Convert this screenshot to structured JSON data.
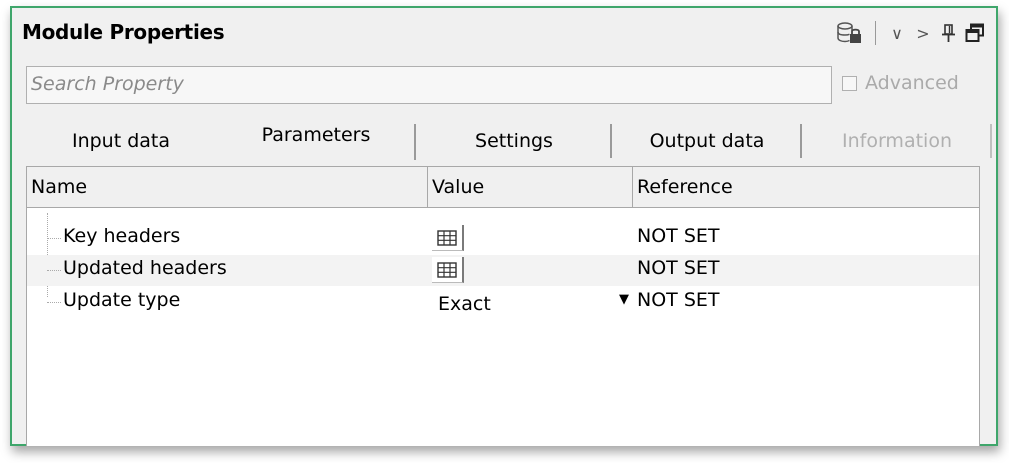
{
  "window": {
    "title": "Module Properties"
  },
  "titlebar": {
    "icons": [
      "database-lock-icon",
      "chevron-down-icon",
      "chevron-right-icon",
      "pin-icon",
      "restore-window-icon"
    ],
    "chevron_down": "∨",
    "chevron_right": ">"
  },
  "search": {
    "placeholder": "Search Property",
    "value": ""
  },
  "advanced": {
    "label": "Advanced",
    "checked": false,
    "enabled": false
  },
  "tabs": [
    {
      "label": "Input data",
      "selected": false,
      "enabled": true
    },
    {
      "label": "Parameters",
      "selected": true,
      "enabled": true
    },
    {
      "label": "Settings",
      "selected": false,
      "enabled": true
    },
    {
      "label": "Output data",
      "selected": false,
      "enabled": true
    },
    {
      "label": "Information",
      "selected": false,
      "enabled": false
    }
  ],
  "grid": {
    "columns": [
      "Name",
      "Value",
      "Reference"
    ],
    "rows": [
      {
        "name": "Key headers",
        "value_type": "table-editor",
        "reference": "NOT SET"
      },
      {
        "name": "Updated headers",
        "value_type": "table-editor",
        "reference": "NOT SET"
      },
      {
        "name": "Update type",
        "value_type": "dropdown",
        "value": "Exact",
        "dropdown_arrow": "▼",
        "reference": "NOT SET"
      }
    ]
  },
  "colors": {
    "panel_border": "#3fa66b",
    "panel_bg": "#f0f0f0",
    "disabled_text": "#b0b0b0"
  }
}
